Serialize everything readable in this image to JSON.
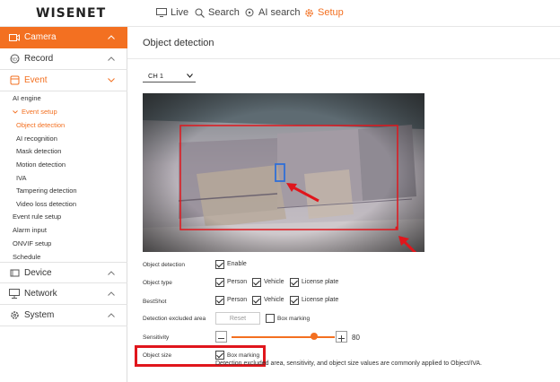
{
  "header": {
    "logo": "WISENET",
    "nav": [
      {
        "label": "Live",
        "icon": "monitor-icon"
      },
      {
        "label": "Search",
        "icon": "search-icon"
      },
      {
        "label": "AI search",
        "icon": "ai-search-icon"
      },
      {
        "label": "Setup",
        "icon": "gear-icon"
      }
    ],
    "active": "Setup"
  },
  "sidebar": {
    "sections": [
      {
        "label": "Camera",
        "icon": "camera-icon",
        "state": "active"
      },
      {
        "label": "Record",
        "icon": "record-icon"
      },
      {
        "label": "Event",
        "icon": "event-icon",
        "state": "open"
      },
      {
        "label": "Device",
        "icon": "device-icon"
      },
      {
        "label": "Network",
        "icon": "network-icon"
      },
      {
        "label": "System",
        "icon": "system-icon"
      }
    ],
    "event_items": [
      {
        "label": "AI engine"
      },
      {
        "label": "Event setup",
        "expanded": true
      },
      {
        "label": "Object detection",
        "selected": true
      },
      {
        "label": "AI recognition"
      },
      {
        "label": "Mask detection"
      },
      {
        "label": "Motion detection"
      },
      {
        "label": "IVA"
      },
      {
        "label": "Tampering detection"
      },
      {
        "label": "Video loss detection"
      },
      {
        "label": "Event rule setup"
      },
      {
        "label": "Alarm input"
      },
      {
        "label": "ONVIF setup"
      },
      {
        "label": "Schedule"
      }
    ]
  },
  "main": {
    "title": "Object detection",
    "channel": "CH 1",
    "rows": {
      "object_detection": {
        "label": "Object detection",
        "enable": "Enable"
      },
      "object_type": {
        "label": "Object type",
        "options": [
          "Person",
          "Vehicle",
          "License plate"
        ]
      },
      "bestshot": {
        "label": "BestShot",
        "options": [
          "Person",
          "Vehicle",
          "License plate"
        ]
      },
      "excluded": {
        "label": "Detection excluded area",
        "reset": "Reset",
        "box_marking": "Box marking"
      },
      "sensitivity": {
        "label": "Sensitivity",
        "value": 80
      },
      "object_size": {
        "label": "Object size",
        "box_marking": "Box marking"
      }
    },
    "note": "Detection excluded area, sensitivity, and object size values are commonly applied to Object/IVA."
  },
  "colors": {
    "accent": "#f37021",
    "annotation_red": "#e0161c",
    "detection_box": "#2f6fd8"
  }
}
